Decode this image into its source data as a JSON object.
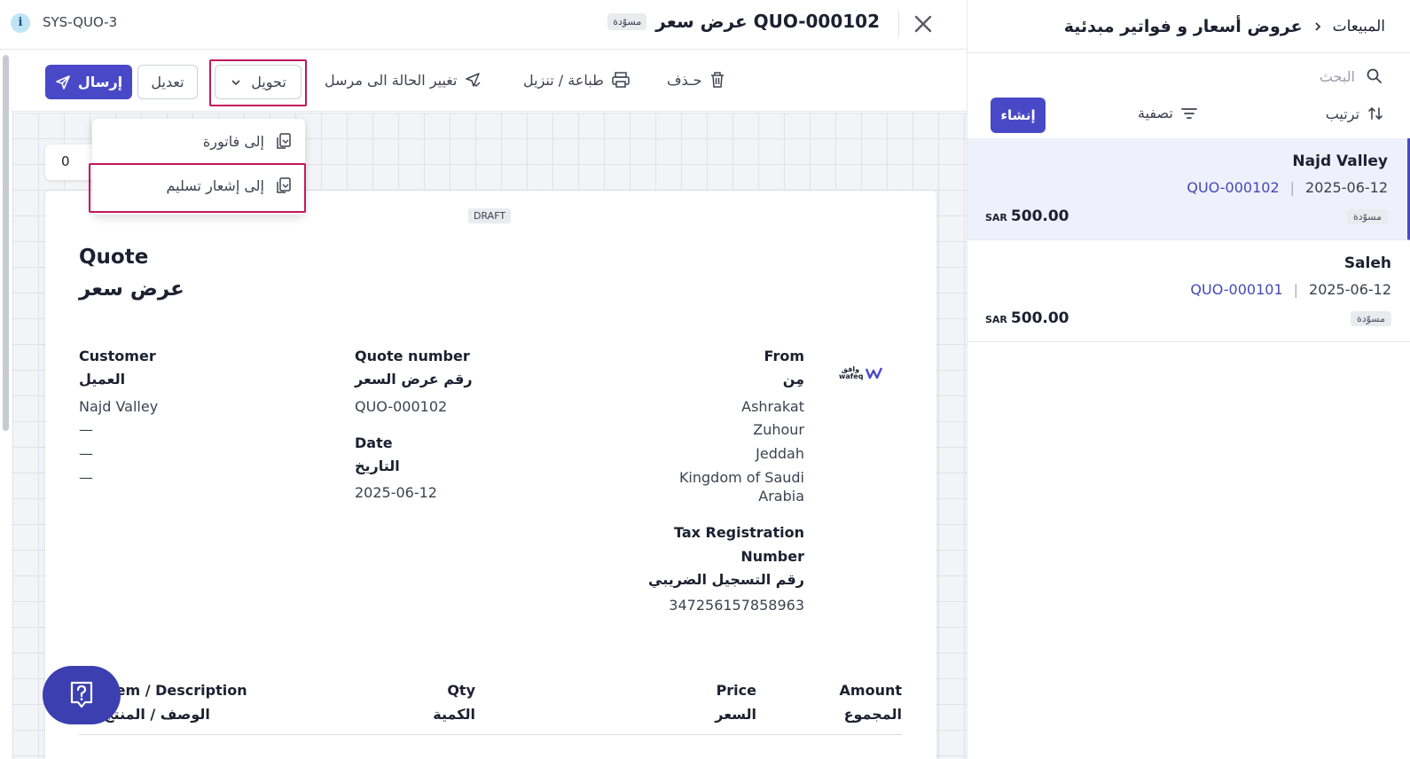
{
  "colors": {
    "brand": "#4949c7",
    "highlight": "#c2185b",
    "link": "#4449b6",
    "badge_bg": "#e9ebef"
  },
  "list_panel": {
    "breadcrumb": {
      "root": "المبيعات",
      "title": "عروض أسعار و فواتير مبدئية"
    },
    "search": {
      "placeholder": "البحث",
      "value": ""
    },
    "create_label": "إنشاء",
    "filter_label": "تصفية",
    "sort_label": "ترتيب",
    "items": [
      {
        "name": "Najd Valley",
        "number": "QUO-000102",
        "date": "2025-06-12",
        "status": "مسوّدة",
        "currency": "SAR",
        "amount": "500.00",
        "selected": true
      },
      {
        "name": "Saleh",
        "number": "QUO-000101",
        "date": "2025-06-12",
        "status": "مسوّدة",
        "currency": "SAR",
        "amount": "500.00",
        "selected": false
      }
    ]
  },
  "detail": {
    "sys_code": "SYS-QUO-3",
    "title": "عرض سعر QUO-000102",
    "title_badge": "مسوّدة",
    "toolbar": {
      "send_label": "إرسال",
      "edit_label": "تعديل",
      "convert_label": "تحويل",
      "change_status_label": "تغيير الحالة الى مرسل",
      "print_label": "طباعة / تنزيل",
      "delete_label": "حـذف"
    },
    "convert_menu": {
      "to_invoice": "إلى فاتورة",
      "to_delivery": "إلى إشعار تسليم"
    },
    "sheet_tab_count": "0",
    "document": {
      "draft_badge": "DRAFT",
      "title_en": "Quote",
      "title_ar": "عرض سعر",
      "logo_text": "وافق wafeq",
      "customer": {
        "label_en": "Customer",
        "label_ar": "العميل",
        "name": "Najd Valley",
        "line1": "—",
        "line2": "—",
        "line3": "—"
      },
      "quote_number": {
        "label_en": "Quote number",
        "label_ar": "رقم عرض السعر",
        "value": "QUO-000102"
      },
      "date": {
        "label_en": "Date",
        "label_ar": "التاريخ",
        "value": "2025-06-12"
      },
      "from": {
        "label_en": "From",
        "label_ar": "مِن",
        "line1": "Ashrakat",
        "line2": "Zuhour",
        "line3": "Jeddah",
        "line4": "Kingdom of Saudi",
        "line5": "Arabia"
      },
      "tax": {
        "label_en_1": "Tax Registration",
        "label_en_2": "Number",
        "label_ar": "رقم التسجيل الضريبي",
        "value": "347256157858963"
      },
      "table": {
        "num": "#",
        "item_en": "Item / Description",
        "item_ar": "الوصف / المنتج",
        "qty_en": "Qty",
        "qty_ar": "الكمية",
        "price_en": "Price",
        "price_ar": "السعر",
        "amount_en": "Amount",
        "amount_ar": "المجموع"
      }
    }
  }
}
